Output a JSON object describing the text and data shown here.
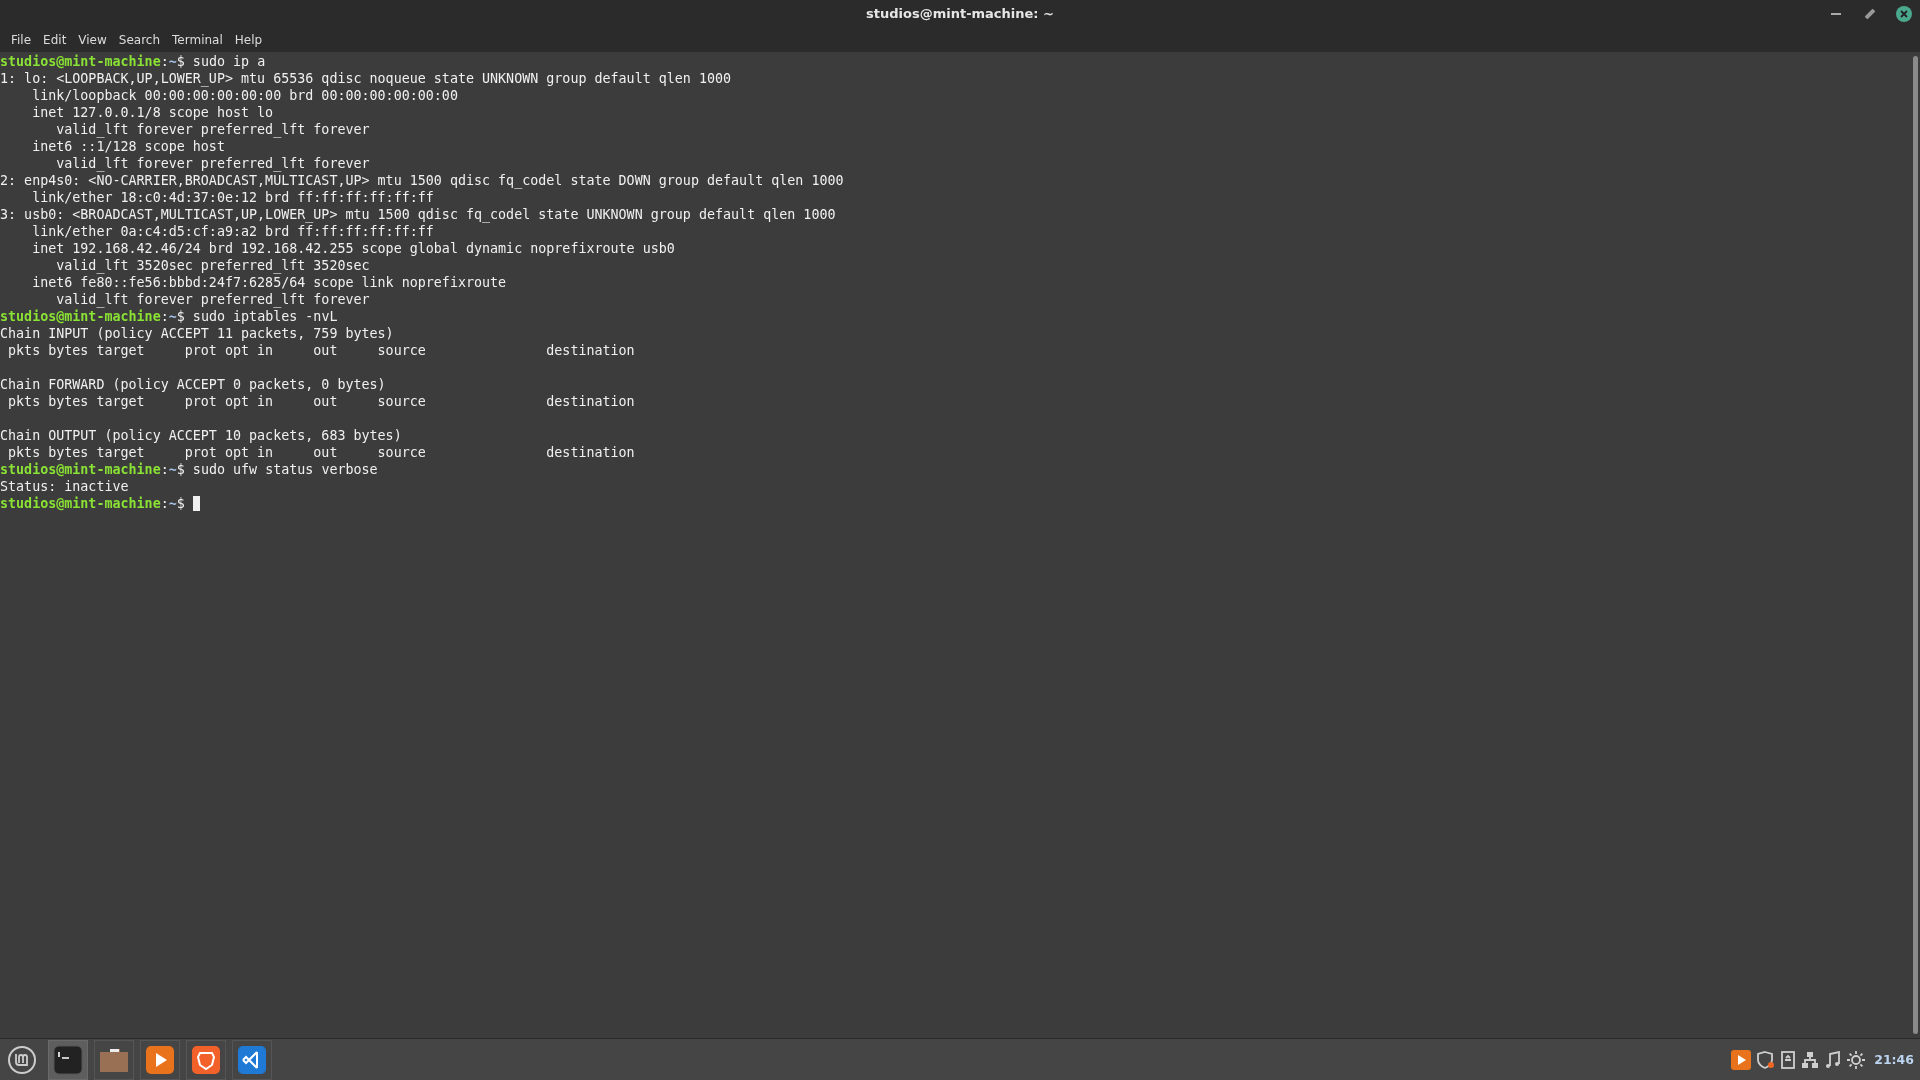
{
  "window": {
    "title": "studios@mint-machine: ~"
  },
  "menu": [
    "File",
    "Edit",
    "View",
    "Search",
    "Terminal",
    "Help"
  ],
  "terminal_lines": [
    {
      "kind": "prompt",
      "user": "studios@mint-machine",
      "sep": ":",
      "path": "~",
      "symbol": "$ ",
      "command": "sudo ip a",
      "cursor": false
    },
    {
      "kind": "output",
      "text": "1: lo: <LOOPBACK,UP,LOWER_UP> mtu 65536 qdisc noqueue state UNKNOWN group default qlen 1000"
    },
    {
      "kind": "output",
      "text": "    link/loopback 00:00:00:00:00:00 brd 00:00:00:00:00:00"
    },
    {
      "kind": "output",
      "text": "    inet 127.0.0.1/8 scope host lo"
    },
    {
      "kind": "output",
      "text": "       valid_lft forever preferred_lft forever"
    },
    {
      "kind": "output",
      "text": "    inet6 ::1/128 scope host"
    },
    {
      "kind": "output",
      "text": "       valid_lft forever preferred_lft forever"
    },
    {
      "kind": "output",
      "text": "2: enp4s0: <NO-CARRIER,BROADCAST,MULTICAST,UP> mtu 1500 qdisc fq_codel state DOWN group default qlen 1000"
    },
    {
      "kind": "output",
      "text": "    link/ether 18:c0:4d:37:0e:12 brd ff:ff:ff:ff:ff:ff"
    },
    {
      "kind": "output",
      "text": "3: usb0: <BROADCAST,MULTICAST,UP,LOWER_UP> mtu 1500 qdisc fq_codel state UNKNOWN group default qlen 1000"
    },
    {
      "kind": "output",
      "text": "    link/ether 0a:c4:d5:cf:a9:a2 brd ff:ff:ff:ff:ff:ff"
    },
    {
      "kind": "output",
      "text": "    inet 192.168.42.46/24 brd 192.168.42.255 scope global dynamic noprefixroute usb0"
    },
    {
      "kind": "output",
      "text": "       valid_lft 3520sec preferred_lft 3520sec"
    },
    {
      "kind": "output",
      "text": "    inet6 fe80::fe56:bbbd:24f7:6285/64 scope link noprefixroute"
    },
    {
      "kind": "output",
      "text": "       valid_lft forever preferred_lft forever"
    },
    {
      "kind": "prompt",
      "user": "studios@mint-machine",
      "sep": ":",
      "path": "~",
      "symbol": "$ ",
      "command": "sudo iptables -nvL",
      "cursor": false
    },
    {
      "kind": "output",
      "text": "Chain INPUT (policy ACCEPT 11 packets, 759 bytes)"
    },
    {
      "kind": "output",
      "text": " pkts bytes target     prot opt in     out     source               destination"
    },
    {
      "kind": "blank"
    },
    {
      "kind": "output",
      "text": "Chain FORWARD (policy ACCEPT 0 packets, 0 bytes)"
    },
    {
      "kind": "output",
      "text": " pkts bytes target     prot opt in     out     source               destination"
    },
    {
      "kind": "blank"
    },
    {
      "kind": "output",
      "text": "Chain OUTPUT (policy ACCEPT 10 packets, 683 bytes)"
    },
    {
      "kind": "output",
      "text": " pkts bytes target     prot opt in     out     source               destination"
    },
    {
      "kind": "prompt",
      "user": "studios@mint-machine",
      "sep": ":",
      "path": "~",
      "symbol": "$ ",
      "command": "sudo ufw status verbose",
      "cursor": false
    },
    {
      "kind": "output",
      "text": "Status: inactive"
    },
    {
      "kind": "prompt",
      "user": "studios@mint-machine",
      "sep": ":",
      "path": "~",
      "symbol": "$ ",
      "cursor": true
    }
  ],
  "taskbar": {
    "launchers": [
      {
        "kind": "terminal",
        "selected": true
      },
      {
        "kind": "folder",
        "selected": false
      },
      {
        "kind": "player",
        "selected": false
      },
      {
        "kind": "browser",
        "selected": false
      },
      {
        "kind": "editor",
        "selected": false
      }
    ],
    "tray": [
      {
        "kind": "player"
      },
      {
        "kind": "shield"
      },
      {
        "kind": "drive"
      },
      {
        "kind": "network"
      },
      {
        "kind": "sound"
      },
      {
        "kind": "brightness"
      }
    ],
    "clock": "21:46"
  }
}
